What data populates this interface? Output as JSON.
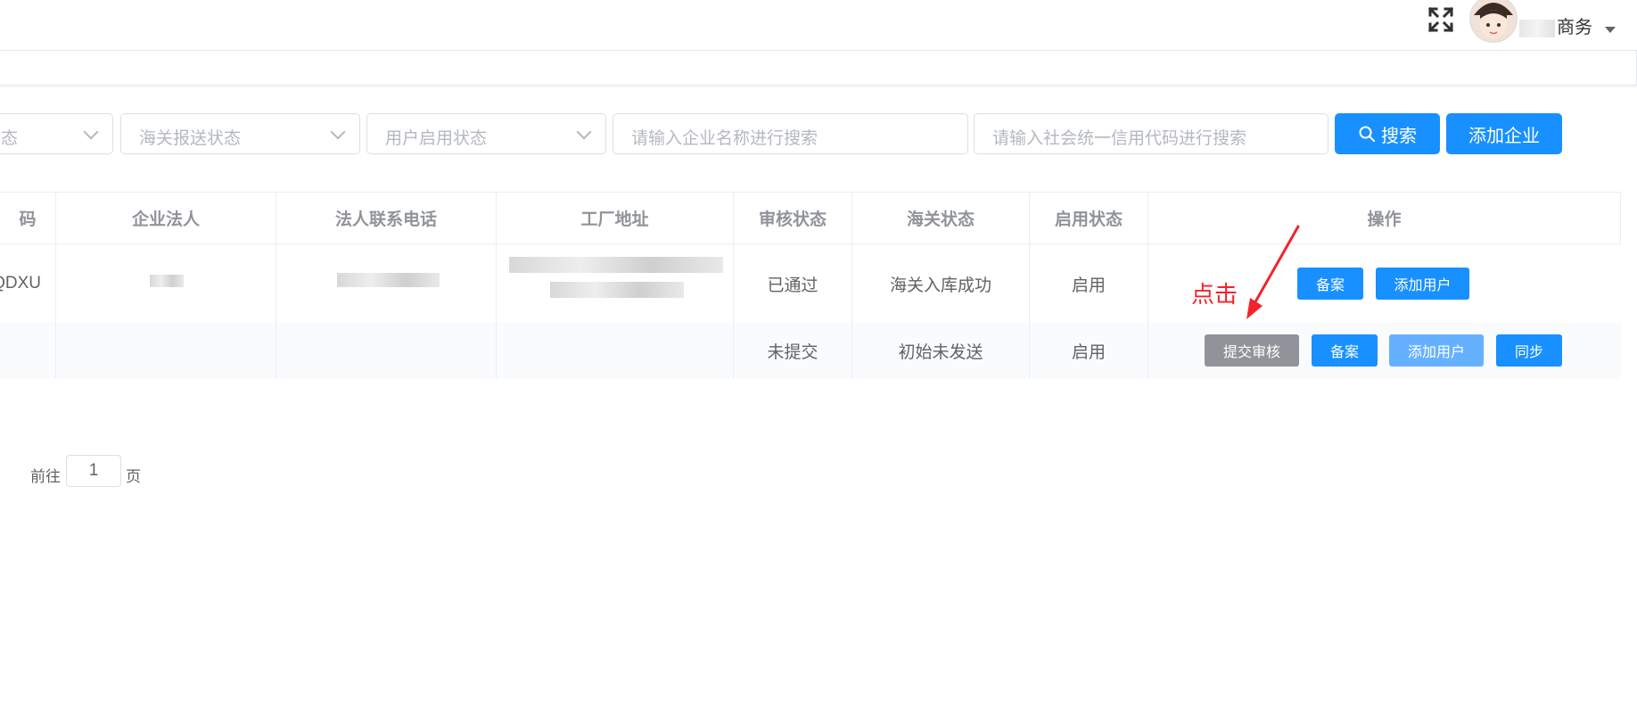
{
  "header": {
    "username_suffix": "商务"
  },
  "filters": {
    "status_select_partial": "态",
    "customs_report_placeholder": "海关报送状态",
    "user_enable_placeholder": "用户启用状态",
    "company_name_placeholder": "请输入企业名称进行搜索",
    "credit_code_placeholder": "请输入社会统一信用代码进行搜索",
    "search_label": "搜索",
    "add_company_label": "添加企业"
  },
  "table": {
    "headers": {
      "code_partial": "码",
      "legal_person": "企业法人",
      "legal_phone": "法人联系电话",
      "factory_address": "工厂地址",
      "review_status": "审核状态",
      "customs_status": "海关状态",
      "enable_status": "启用状态",
      "actions": "操作"
    },
    "rows": [
      {
        "code_partial": "QDXU",
        "review_status": "已通过",
        "customs_status": "海关入库成功",
        "enable_status": "启用",
        "actions": {
          "record": "备案",
          "add_user": "添加用户"
        }
      },
      {
        "code_partial": "",
        "review_status": "未提交",
        "customs_status": "初始未发送",
        "enable_status": "启用",
        "actions": {
          "submit_review": "提交审核",
          "record": "备案",
          "add_user": "添加用户",
          "sync": "同步"
        }
      }
    ]
  },
  "annotation": {
    "text": "点击",
    "color": "#f5222d"
  },
  "pagination": {
    "goto_label": "前往",
    "current_page": "1",
    "page_unit": "页"
  },
  "colors": {
    "primary": "#1890ff",
    "gray_button": "#909399",
    "light_primary": "#66b1ff"
  }
}
